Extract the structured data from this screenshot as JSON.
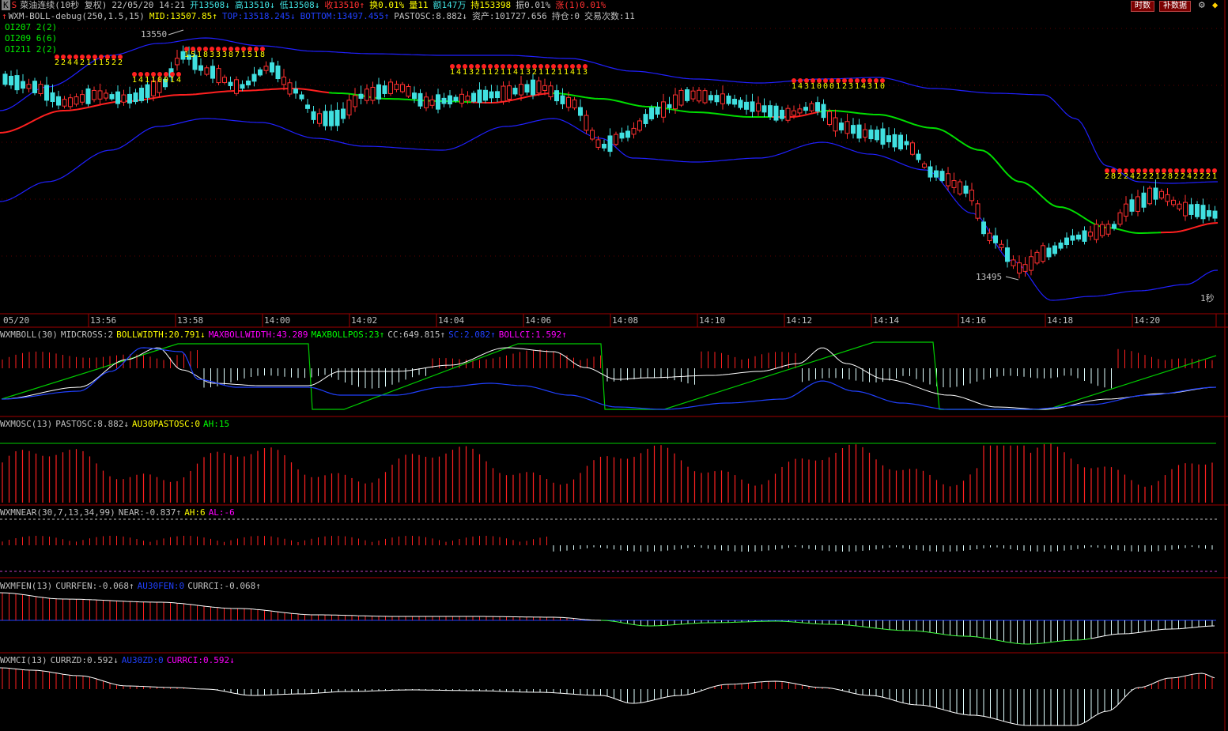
{
  "header": {
    "k_label": "K",
    "s_label": "S",
    "instrument": "菜油连续(10秒 复权)",
    "datetime": "22/05/20 14:21",
    "open": "开13508↓",
    "high": "高13510↓",
    "low": "低13508↓",
    "close": "收13510↑",
    "turnover": "换0.01%",
    "volume": "量11",
    "amount": "额147万",
    "hold": "持153398",
    "amplitude": "振0.01%",
    "change": "涨(1)0.01%"
  },
  "toolbar": {
    "fenshi": "时数",
    "buju": "补数据"
  },
  "main_legend": {
    "name": "WXM-BOLL-debug(250,1.5,15)",
    "mid": "MID:13507.85↑",
    "top": "TOP:13518.245↓",
    "bottom": "BOTTOM:13497.455↑",
    "pastosc": "PASTOSC:8.882↓",
    "asset": "资产:101727.656",
    "position": "持仓:0",
    "trades": "交易次数:11"
  },
  "oi_list": [
    {
      "name": "OI207",
      "val": "2(2)"
    },
    {
      "name": "OI209",
      "val": "6(6)"
    },
    {
      "name": "OI211",
      "val": "2(2)"
    }
  ],
  "main_chart": {
    "high_label": "13550",
    "low_label": "13495",
    "interval_label": "1秒"
  },
  "time_axis": [
    "05/20",
    "13:56",
    "13:58",
    "14:00",
    "14:02",
    "14:04",
    "14:06",
    "14:08",
    "14:10",
    "14:12",
    "14:14",
    "14:16",
    "14:18",
    "14:20"
  ],
  "panels": [
    {
      "id": "boll",
      "items": [
        {
          "t": "WXMBOLL(30)",
          "c": "#c0c0c0"
        },
        {
          "t": "MIDCROSS:2",
          "c": "#c0c0c0"
        },
        {
          "t": "BOLLWIDTH:20.791↓",
          "c": "#ffff00"
        },
        {
          "t": "MAXBOLLWIDTH:43.289",
          "c": "#ff00ff"
        },
        {
          "t": "MAXBOLLPOS:23↑",
          "c": "#00ff00"
        },
        {
          "t": "CC:649.815↑",
          "c": "#c0c0c0"
        },
        {
          "t": "SC:2.082↑",
          "c": "#2040ff"
        },
        {
          "t": "BOLLCI:1.592↑",
          "c": "#ff00ff"
        }
      ]
    },
    {
      "id": "osc",
      "items": [
        {
          "t": "WXMOSC(13)",
          "c": "#c0c0c0"
        },
        {
          "t": "PASTOSC:8.882↓",
          "c": "#c0c0c0"
        },
        {
          "t": "AU30PASTOSC:0",
          "c": "#ffff00"
        },
        {
          "t": "AH:15",
          "c": "#00ff00"
        }
      ]
    },
    {
      "id": "near",
      "items": [
        {
          "t": "WXMNEAR(30,7,13,34,99)",
          "c": "#c0c0c0"
        },
        {
          "t": "NEAR:-0.837↑",
          "c": "#c0c0c0"
        },
        {
          "t": "AH:6",
          "c": "#ffff00"
        },
        {
          "t": "AL:-6",
          "c": "#ff00ff"
        }
      ]
    },
    {
      "id": "fen",
      "items": [
        {
          "t": "WXMFEN(13)",
          "c": "#c0c0c0"
        },
        {
          "t": "CURRFEN:-0.068↑",
          "c": "#c0c0c0"
        },
        {
          "t": "AU30FEN:0",
          "c": "#2040ff"
        },
        {
          "t": "CURRCI:-0.068↑",
          "c": "#c0c0c0"
        }
      ]
    },
    {
      "id": "ci",
      "items": [
        {
          "t": "WXMCI(13)",
          "c": "#c0c0c0"
        },
        {
          "t": "CURRZD:0.592↓",
          "c": "#c0c0c0"
        },
        {
          "t": "AU30ZD:0",
          "c": "#2040ff"
        },
        {
          "t": "CURRCI:0.592↓",
          "c": "#ff00ff"
        }
      ]
    }
  ],
  "colors": {
    "up": "#ff3030",
    "down": "#40e0e0",
    "mid": "#00dd00",
    "band": "#2020ff",
    "grid": "#a00000"
  }
}
